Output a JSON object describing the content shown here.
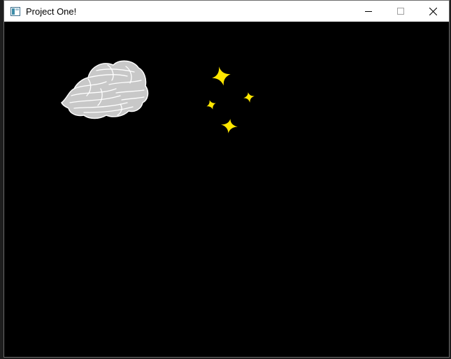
{
  "window": {
    "title": "Project One!",
    "canvas_background": "#000000"
  },
  "controls": {
    "minimize_icon": "minimize-icon",
    "maximize_icon": "maximize-icon",
    "close_icon": "close-icon"
  },
  "scene": {
    "cloud_color": "#c8c8c8",
    "cloud_outline": "#ffffff",
    "star_color": "#ffe600",
    "star_count": 4
  },
  "colors": {
    "titlebar": "#ffffff",
    "canvas": "#000000",
    "star": "#ffe600",
    "cloud": "#c8c8c8"
  }
}
